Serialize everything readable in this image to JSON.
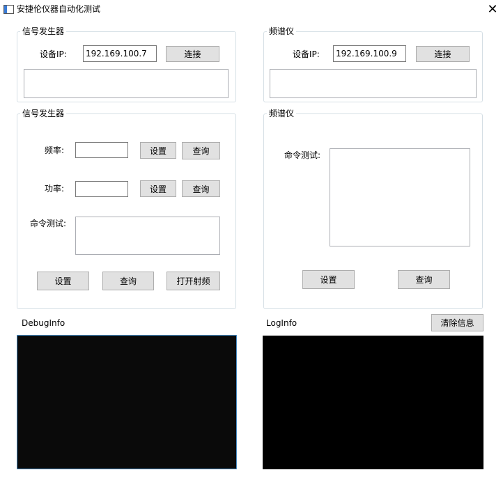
{
  "window": {
    "title": "安捷伦仪器自动化测试",
    "close_glyph": "✕"
  },
  "siggen_connect": {
    "legend": "信号发生器",
    "ip_label": "设备IP:",
    "ip_value": "192.169.100.7",
    "connect_label": "连接"
  },
  "spec_connect": {
    "legend": "频谱仪",
    "ip_label": "设备IP:",
    "ip_value": "192.169.100.9",
    "connect_label": "连接"
  },
  "siggen_ctrl": {
    "legend": "信号发生器",
    "freq_label": "频率:",
    "freq_value": "",
    "freq_set_label": "设置",
    "freq_query_label": "查询",
    "power_label": "功率:",
    "power_value": "",
    "power_set_label": "设置",
    "power_query_label": "查询",
    "cmd_label": "命令测试:",
    "cmd_value": "",
    "set_label": "设置",
    "query_label": "查询",
    "rf_on_label": "打开射频"
  },
  "spec_ctrl": {
    "legend": "频谱仪",
    "cmd_label": "命令测试:",
    "cmd_value": "",
    "set_label": "设置",
    "query_label": "查询"
  },
  "debug": {
    "label": "DebugInfo",
    "background": "#0a0a0a",
    "border": "#4a90c8"
  },
  "log": {
    "label": "LogInfo",
    "clear_label": "清除信息",
    "background": "#000000"
  },
  "colors": {
    "button_bg": "#e1e1e1",
    "button_border": "#adadad",
    "group_border": "#d5dfe5",
    "accent": "#3a7bd5"
  },
  "icons": {
    "app": "app-window-icon",
    "close": "close-icon"
  }
}
